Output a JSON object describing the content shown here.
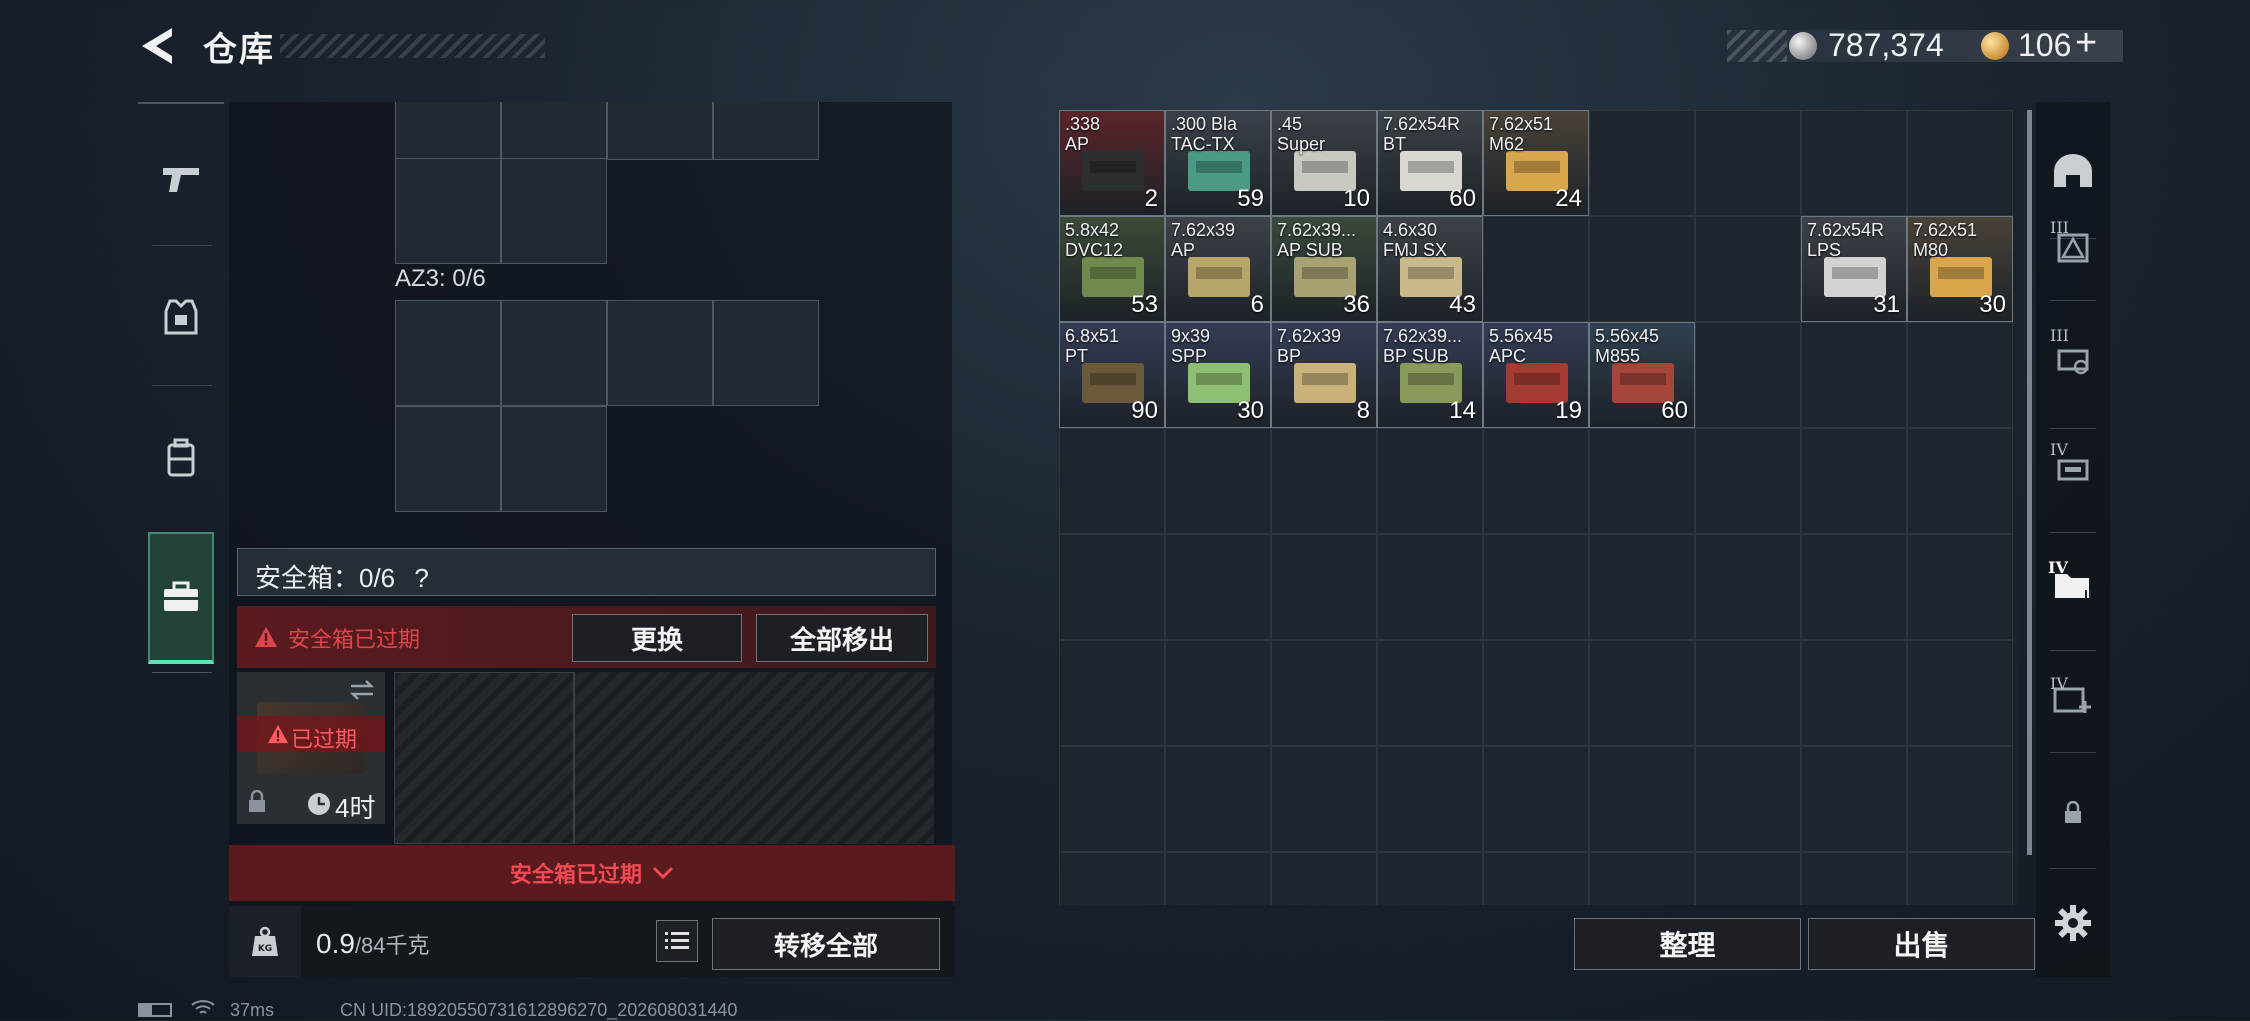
{
  "header": {
    "title": "仓库"
  },
  "currency": {
    "silver": "787,374",
    "gold": "106",
    "plus": "+"
  },
  "loadout": {
    "az3_label": "AZ3: 0/6"
  },
  "safebox": {
    "label": "安全箱：0/6",
    "help": "?",
    "expired_warning": "安全箱已过期",
    "replace_button": "更换",
    "remove_all_button": "全部移出",
    "case_status": "已过期",
    "case_timer": "4时",
    "footer_text": "安全箱已过期"
  },
  "bottom": {
    "weight_value": "0.9",
    "weight_capacity": "/84千克",
    "transfer_all_button": "转移全部"
  },
  "stash": {
    "items": [
      {
        "name": ".338\nAP",
        "count": "2",
        "row": 0,
        "col": 0,
        "bg": "#5b2529",
        "box": "#2c2f31"
      },
      {
        "name": ".300 Bla\nTAC-TX",
        "count": "59",
        "row": 0,
        "col": 1,
        "bg": "#3a4148",
        "box": "#4a9a86"
      },
      {
        "name": ".45\nSuper",
        "count": "10",
        "row": 0,
        "col": 2,
        "bg": "#3d4249",
        "box": "#c8c8c0"
      },
      {
        "name": "7.62x54R\nBT",
        "count": "60",
        "row": 0,
        "col": 3,
        "bg": "#3d4249",
        "box": "#d8d8d0"
      },
      {
        "name": "7.62x51\nM62",
        "count": "24",
        "row": 0,
        "col": 4,
        "bg": "#4a4238",
        "box": "#d8a64c"
      },
      {
        "name": "5.8x42\nDVC12",
        "count": "53",
        "row": 1,
        "col": 0,
        "bg": "#3c4a36",
        "box": "#6f8a4c"
      },
      {
        "name": "7.62x39\nAP",
        "count": "6",
        "row": 1,
        "col": 1,
        "bg": "#3d4249",
        "box": "#b7a66a"
      },
      {
        "name": "7.62x39...\nAP SUB",
        "count": "36",
        "row": 1,
        "col": 2,
        "bg": "#3a4a3a",
        "box": "#a8a272"
      },
      {
        "name": "4.6x30\nFMJ SX",
        "count": "43",
        "row": 1,
        "col": 3,
        "bg": "#3d4249",
        "box": "#c9b98a"
      },
      {
        "name": "7.62x54R\nLPS",
        "count": "31",
        "row": 1,
        "col": 7,
        "bg": "#3d4249",
        "box": "#d2d2d2"
      },
      {
        "name": "7.62x51\nM80",
        "count": "30",
        "row": 1,
        "col": 8,
        "bg": "#4a4238",
        "box": "#d8a64c"
      },
      {
        "name": "6.8x51\nPT",
        "count": "90",
        "row": 2,
        "col": 0,
        "bg": "#343c55",
        "box": "#6b5a3a"
      },
      {
        "name": "9x39\nSPP",
        "count": "30",
        "row": 2,
        "col": 1,
        "bg": "#343c55",
        "box": "#8fbf72"
      },
      {
        "name": "7.62x39\nBP",
        "count": "8",
        "row": 2,
        "col": 2,
        "bg": "#343c55",
        "box": "#c8b27a"
      },
      {
        "name": "7.62x39...\nBP SUB",
        "count": "14",
        "row": 2,
        "col": 3,
        "bg": "#343c55",
        "box": "#8a9a5a"
      },
      {
        "name": "5.56x45\nAPC",
        "count": "19",
        "row": 2,
        "col": 4,
        "bg": "#343c55",
        "box": "#a33b32"
      },
      {
        "name": "5.56x45\nM855",
        "count": "60",
        "row": 2,
        "col": 5,
        "bg": "#2f4150",
        "box": "#a5463a"
      }
    ],
    "sort_button": "整理",
    "sell_button": "出售"
  },
  "right_nav": {
    "tiers": [
      "III",
      "III",
      "IV",
      "IV",
      "IV"
    ]
  },
  "status_bar": {
    "ping": "37ms",
    "uid": "CN UID:18920550731612896270_202608031440"
  },
  "colors": {
    "accent_green": "#5de0b2",
    "warning_red": "#e0444b",
    "expired_bg": "#5a1a1e"
  }
}
